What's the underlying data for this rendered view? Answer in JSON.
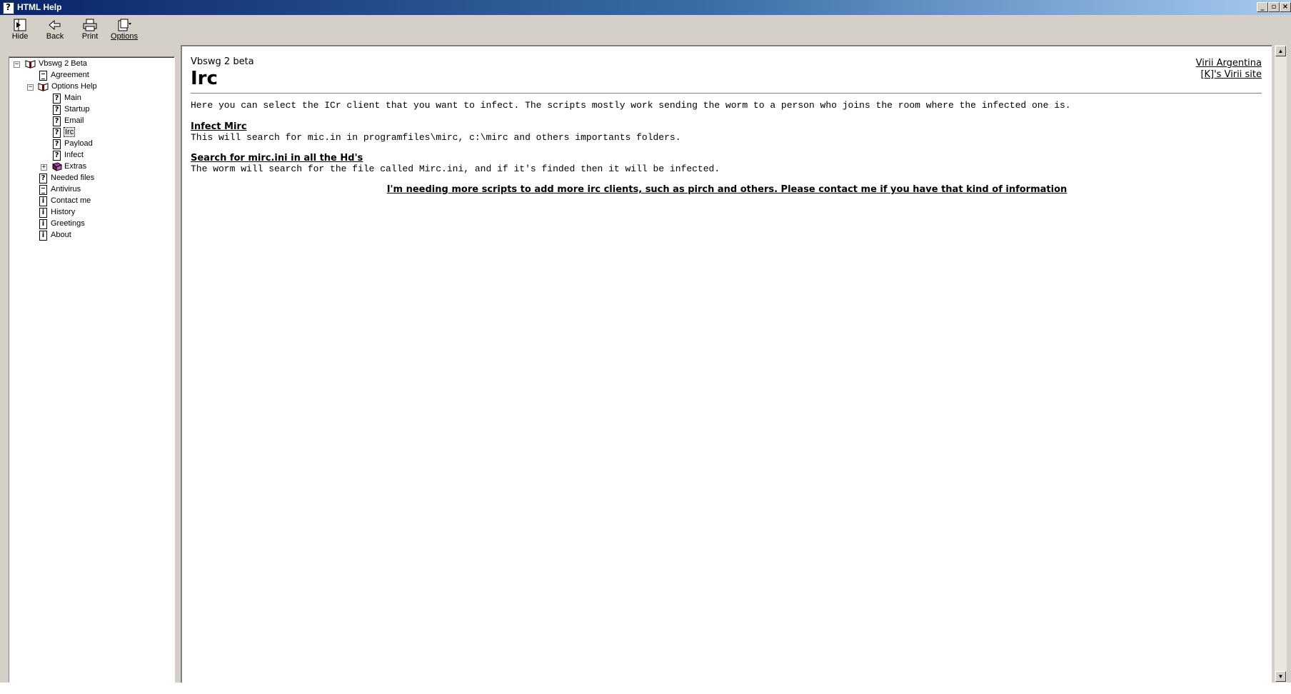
{
  "window": {
    "title": "HTML Help"
  },
  "toolbar": {
    "buttons": [
      {
        "label": "Hide",
        "icon": "hide-icon"
      },
      {
        "label": "Back",
        "icon": "back-arrow-icon"
      },
      {
        "label": "Print",
        "icon": "printer-icon"
      },
      {
        "label": "Options",
        "icon": "options-icon"
      }
    ]
  },
  "toc": {
    "items": [
      {
        "label": "Vbswg 2 Beta",
        "icon": "open-book-icon",
        "expander": "−"
      },
      {
        "label": "Agreement",
        "icon": "page-icon"
      },
      {
        "label": "Options Help",
        "icon": "open-book-icon",
        "expander": "−"
      },
      {
        "label": "Main",
        "icon": "help-page-icon"
      },
      {
        "label": "Startup",
        "icon": "help-page-icon"
      },
      {
        "label": "Email",
        "icon": "help-page-icon"
      },
      {
        "label": "Irc",
        "icon": "help-page-icon",
        "selected": true
      },
      {
        "label": "Payload",
        "icon": "help-page-icon"
      },
      {
        "label": "Infect",
        "icon": "help-page-icon"
      },
      {
        "label": "Extras",
        "icon": "closed-book-icon",
        "expander": "+"
      },
      {
        "label": "Needed files",
        "icon": "help-page-icon"
      },
      {
        "label": "Antivirus",
        "icon": "page-icon"
      },
      {
        "label": "Contact me",
        "icon": "info-page-icon"
      },
      {
        "label": "History",
        "icon": "info-page-icon"
      },
      {
        "label": "Greetings",
        "icon": "info-page-icon"
      },
      {
        "label": "About",
        "icon": "info-page-icon"
      }
    ]
  },
  "content": {
    "subtitle": "Vbswg 2 beta",
    "title": "Irc",
    "links_top": [
      "Virii Argentina",
      "[K]'s Virii site"
    ],
    "intro": "Here you can select the ICr client that you want to infect. The scripts mostly work sending the worm to a person who joins the room where the infected one is.",
    "sections": [
      {
        "heading": "Infect Mirc",
        "text": "This will search for mic.in in programfiles\\mirc, c:\\mirc and others importants folders."
      },
      {
        "heading": "Search for mirc.ini in all the Hd's",
        "text": "The worm will search for the file called Mirc.ini, and if it's finded then it will be infected."
      }
    ],
    "note": "I'm needing more scripts to add more irc clients, such as pirch and others. Please contact me if you have that kind of information"
  },
  "colors": {
    "titlebar_start": "#0a246a",
    "titlebar_end": "#a6caf0",
    "chrome": "#d4d0c8"
  }
}
